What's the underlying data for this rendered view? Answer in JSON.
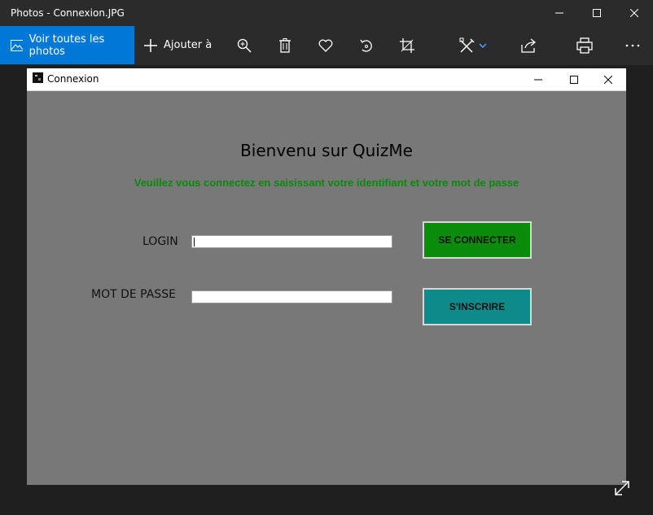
{
  "app": {
    "title": "Photos - Connexion.JPG",
    "window_controls": [
      "minimize",
      "maximize",
      "close"
    ]
  },
  "toolbar": {
    "all_photos_label": "Voir toutes les photos",
    "add_label": "Ajouter à",
    "tools": [
      "zoom-icon",
      "delete-icon",
      "heart-icon",
      "rotate-icon",
      "crop-icon",
      "edit-icon",
      "share-icon",
      "print-icon",
      "more-icon"
    ],
    "accent": "#0078d7"
  },
  "connexion": {
    "window_title": "Connexion",
    "welcome": "Bienvenu sur QuizMe",
    "instructions": "Veuillez vous connectez en saisissant votre identifiant et votre mot de passe",
    "login_label": "LOGIN",
    "password_label": "MOT DE PASSE",
    "login_value": "",
    "password_value": "",
    "connect_label": "SE CONNECTER",
    "register_label": "S'INSCRIRE",
    "colors": {
      "background": "#787878",
      "instructions": "#0a8a0a",
      "connect_button": "#0a8c0a",
      "register_button": "#0f8a8a"
    }
  }
}
